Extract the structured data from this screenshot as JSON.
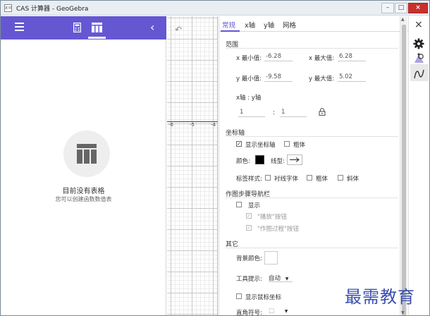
{
  "window": {
    "title": "CAS 计算器 - GeoGebra",
    "min": "–",
    "max": "□",
    "close": "×",
    "icon": "x="
  },
  "left": {
    "empty_title": "目前没有表格",
    "empty_sub": "您可以创建函数数值表",
    "icons": [
      "menu-icon",
      "calculator-icon",
      "table-icon",
      "chevron-left-icon"
    ]
  },
  "graphics": {
    "ticks": [
      "-6",
      "-5",
      "-4"
    ]
  },
  "props": {
    "tabs": [
      "常规",
      "x轴",
      "y轴",
      "网格"
    ],
    "range": {
      "section": "范围",
      "xmin_label": "x 最小值:",
      "xmin": "-6.28",
      "xmax_label": "x 最大值:",
      "xmax": "6.28",
      "ymin_label": "y 最小值:",
      "ymin": "-9.58",
      "ymax_label": "y 最大值:",
      "ymax": "5.02",
      "ratio_label": "x轴 : y轴",
      "ratio_x": "1",
      "colon": ":",
      "ratio_y": "1"
    },
    "axes": {
      "section": "坐标轴",
      "show_axes": "显示坐标轴",
      "show_axes_checked": true,
      "bold": "粗体",
      "color_label": "颜色:",
      "color": "#000000",
      "linetype_label": "线型:",
      "label_style": "标签样式:",
      "serif": "衬线字体",
      "bold2": "粗体",
      "italic": "斜体"
    },
    "navbar": {
      "section": "作图步骤导航栏",
      "show": "显示",
      "play": "\"播放\"按钮",
      "construction": "\"作图过程\"按钮"
    },
    "misc": {
      "section": "其它",
      "bg_label": "背景颜色:",
      "tooltip_label": "工具提示:",
      "tooltip_value": "自动",
      "show_mouse": "显示鼠标坐标",
      "right_angle": "直角符号:",
      "right_angle_value": "□"
    }
  },
  "sidebar": {
    "close": "×",
    "icons": [
      "close-icon",
      "gear-icon",
      "graphics-style-icon",
      "curve-icon"
    ]
  },
  "watermark": "最需教育",
  "colors": {
    "accent": "#6557d2",
    "watermark": "#3a4fb0"
  }
}
